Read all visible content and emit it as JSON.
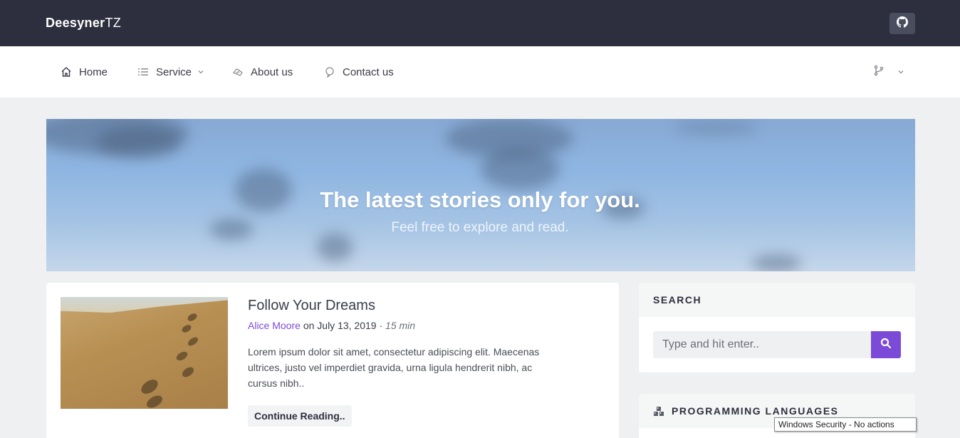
{
  "brand": {
    "bold": "Deesyner",
    "light": "TZ"
  },
  "topbar": {
    "github_icon": "github-icon"
  },
  "nav": {
    "items": [
      {
        "label": "Home",
        "icon": "home-icon"
      },
      {
        "label": "Service",
        "icon": "list-icon",
        "dropdown": true
      },
      {
        "label": "About us",
        "icon": "handshake-icon"
      },
      {
        "label": "Contact us",
        "icon": "chat-bubble-icon"
      }
    ],
    "right_icon": "git-branch-icon"
  },
  "hero": {
    "title": "The latest stories only for you.",
    "subtitle": "Feel free to explore and read."
  },
  "post": {
    "title": "Follow Your Dreams",
    "author": "Alice Moore",
    "on": "on",
    "date": "July 13, 2019",
    "separator": "·",
    "read_time": "15 min",
    "excerpt": "Lorem ipsum dolor sit amet, consectetur adipiscing elit. Maecenas ultrices, justo vel imperdiet gravida, urna ligula hendrerit nibh, ac cursus nibh..",
    "button": "Continue Reading.."
  },
  "search_widget": {
    "title": "SEARCH",
    "placeholder": "Type and hit enter..",
    "button_icon": "search-icon"
  },
  "languages_widget": {
    "title": "PROGRAMMING LANGUAGES",
    "icon": "cubes-icon"
  },
  "tooltip": {
    "text": "Windows Security - No actions"
  },
  "colors": {
    "accent": "#7b4ad6",
    "topbar": "#2d2f3e",
    "background": "#eff0f1"
  }
}
